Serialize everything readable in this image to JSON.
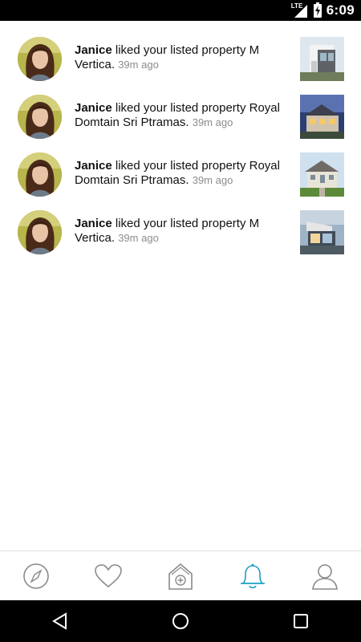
{
  "status_bar": {
    "network": "LTE",
    "time": "6:09"
  },
  "notifications": [
    {
      "user": "Janice",
      "message": " liked your listed property M Vertica.",
      "time": "39m ago",
      "thumb": "modern-house"
    },
    {
      "user": "Janice",
      "message": " liked your listed property Royal Domtain Sri Ptramas.",
      "time": "39m ago",
      "thumb": "twilight-house"
    },
    {
      "user": "Janice",
      "message": " liked your listed property Royal Domtain Sri Ptramas.",
      "time": "39m ago",
      "thumb": "suburban-house"
    },
    {
      "user": "Janice",
      "message": " liked your listed property M Vertica.",
      "time": "39m ago",
      "thumb": "glass-villa"
    }
  ],
  "tab_bar": {
    "active_tab": "notifications",
    "active_color": "#1aa0c4",
    "inactive_color": "#8a8a8a",
    "tabs": [
      "compass-icon",
      "heart-icon",
      "add-home-icon",
      "bell-icon",
      "profile-icon"
    ]
  },
  "nav_bar": {
    "buttons": [
      "back-icon",
      "home-icon",
      "recents-icon"
    ]
  }
}
